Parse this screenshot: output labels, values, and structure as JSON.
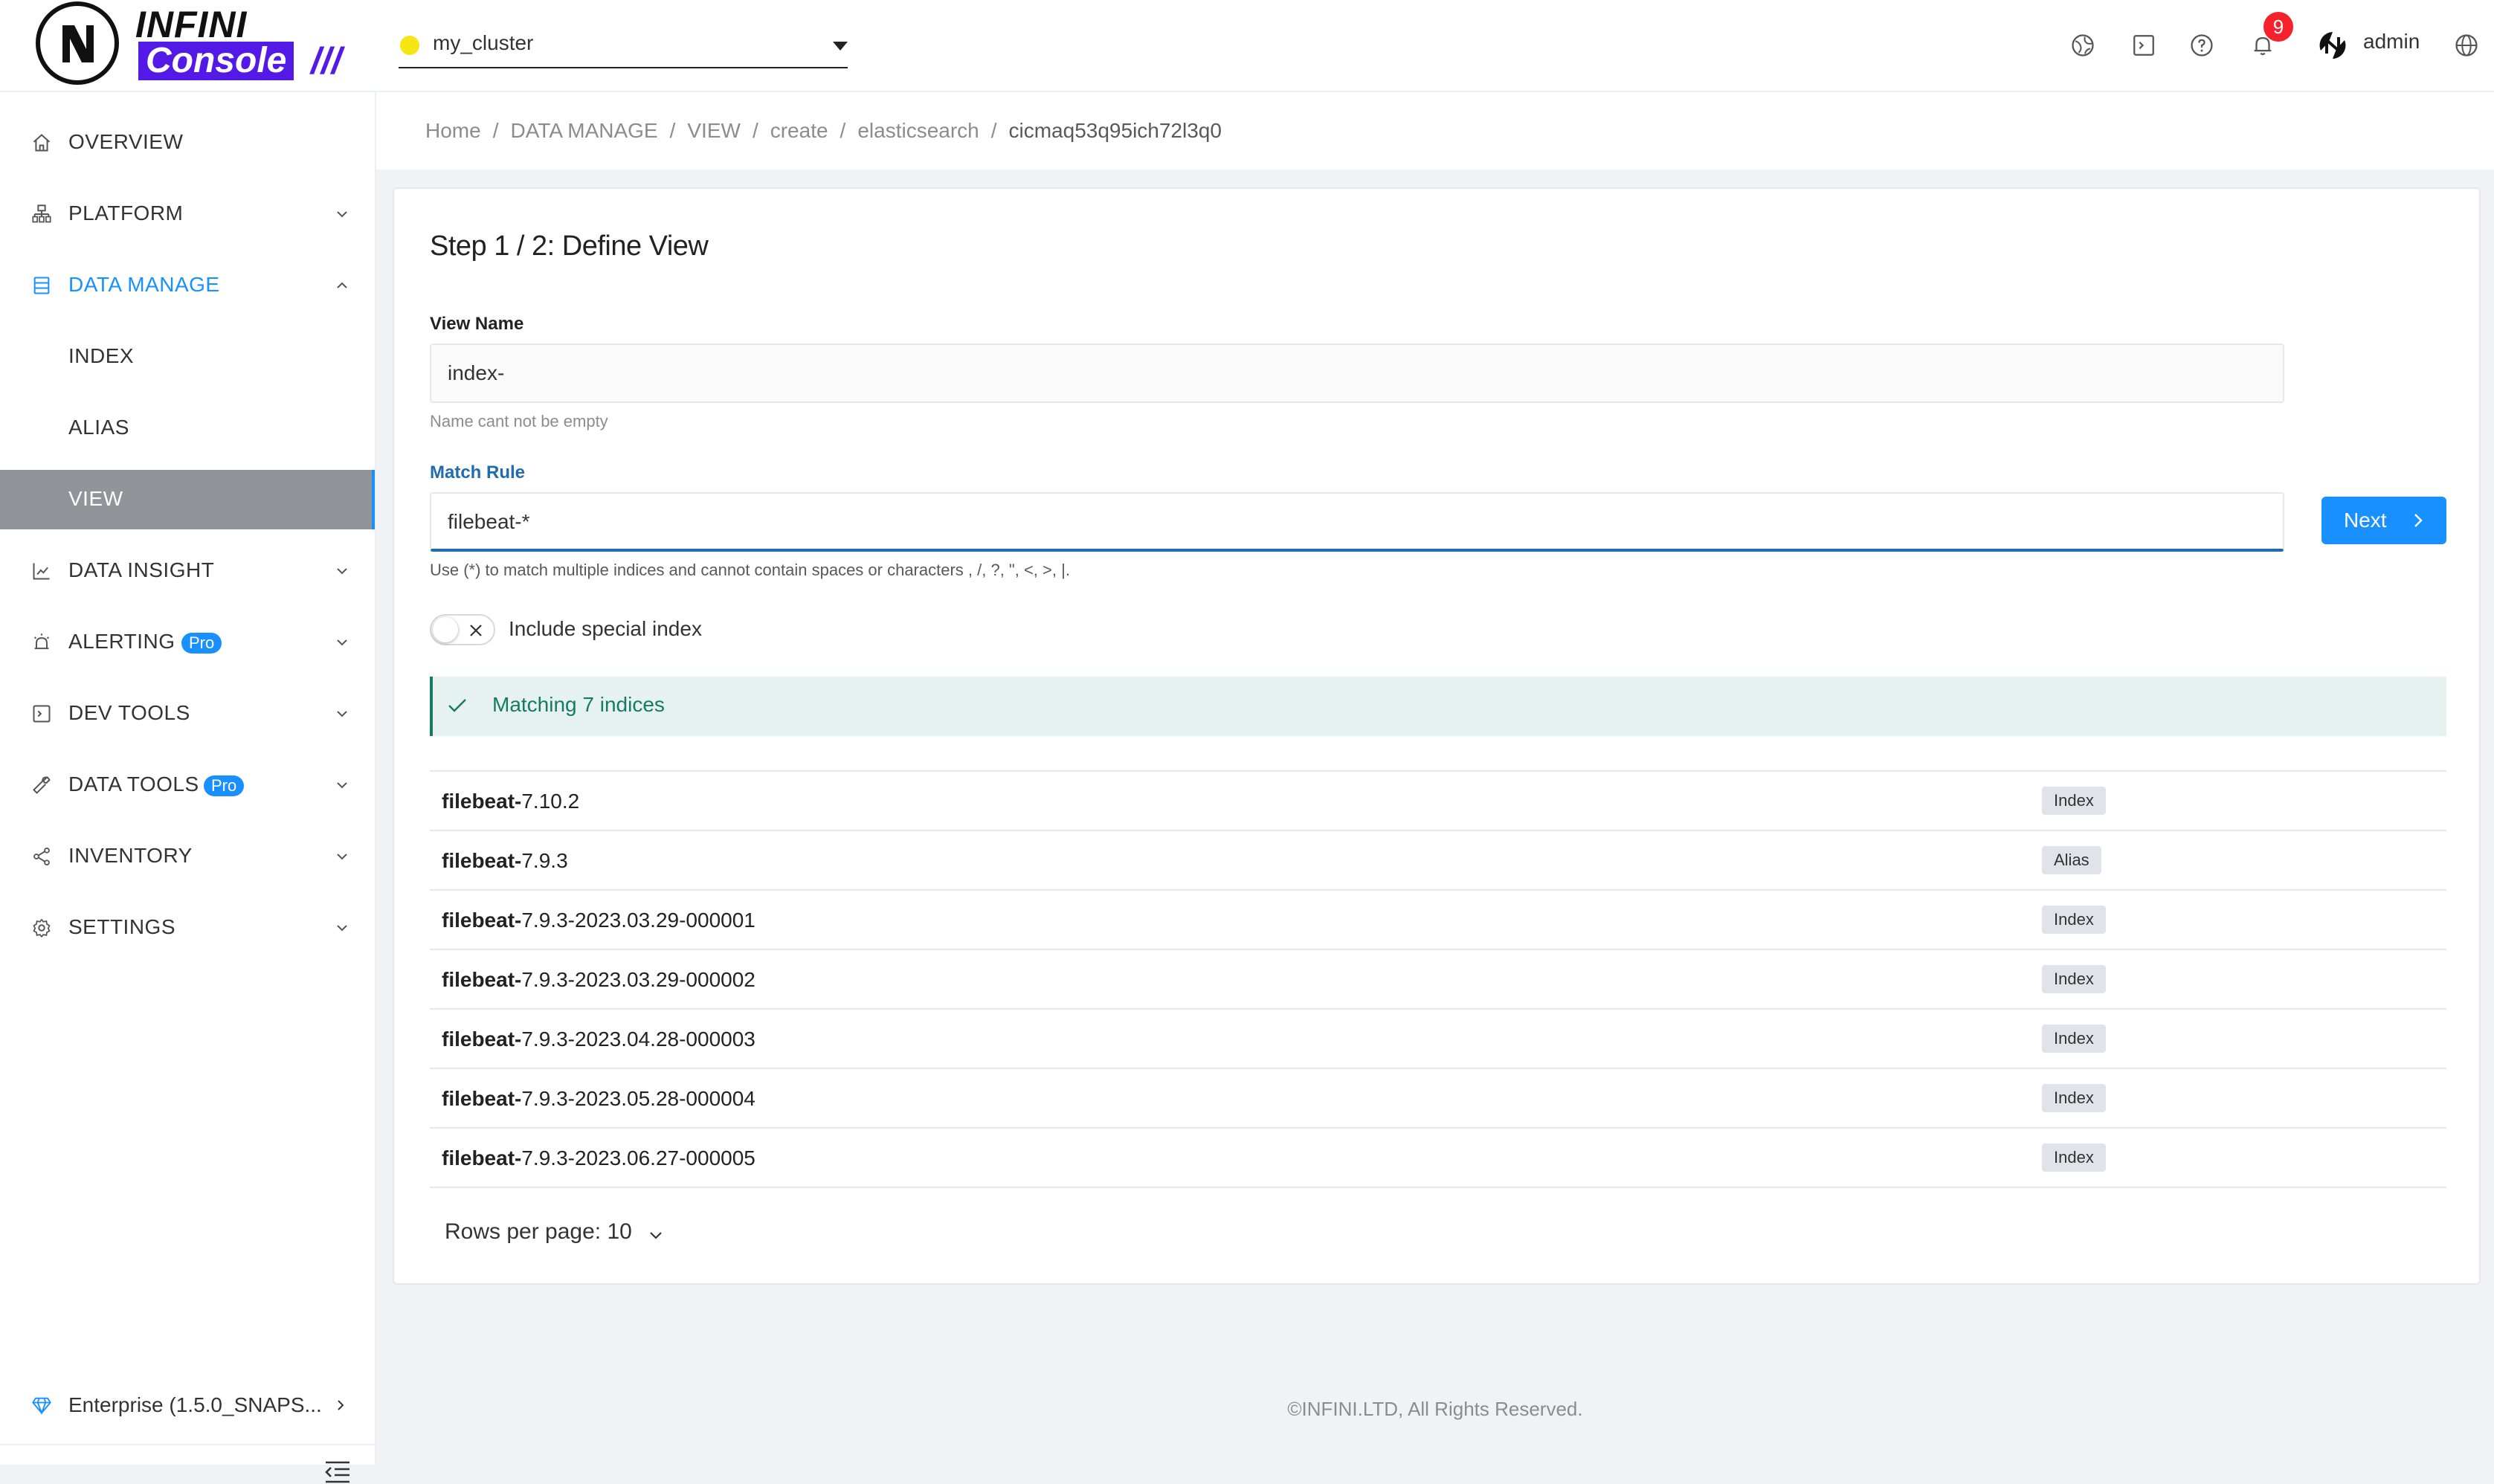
{
  "brand": {
    "name_top": "INFINI",
    "name_bottom": "Console",
    "slashes": "///"
  },
  "header": {
    "cluster": {
      "name": "my_cluster",
      "status_color": "#f5e614"
    },
    "icons": [
      "language-icon",
      "terminal-icon",
      "help-icon",
      "bell-icon"
    ],
    "notifications_count": "9",
    "user": "admin"
  },
  "sidebar": {
    "items": [
      {
        "label": "OVERVIEW",
        "icon": "home-icon"
      },
      {
        "label": "PLATFORM",
        "icon": "platform-icon"
      },
      {
        "label": "DATA MANAGE",
        "icon": "database-icon"
      },
      {
        "label": "INDEX"
      },
      {
        "label": "ALIAS"
      },
      {
        "label": "VIEW"
      },
      {
        "label": "DATA INSIGHT",
        "icon": "chart-icon"
      },
      {
        "label": "ALERTING",
        "icon": "alarm-icon",
        "badge": "Pro"
      },
      {
        "label": "DEV TOOLS",
        "icon": "terminal-icon"
      },
      {
        "label": "DATA TOOLS",
        "icon": "wrench-icon",
        "badge": "Pro"
      },
      {
        "label": "INVENTORY",
        "icon": "share-icon"
      },
      {
        "label": "SETTINGS",
        "icon": "gear-icon"
      }
    ],
    "footer": {
      "edition": "Enterprise (1.5.0_SNAPS..."
    }
  },
  "breadcrumb": [
    "Home",
    "DATA MANAGE",
    "VIEW",
    "create",
    "elasticsearch",
    "cicmaq53q95ich72l3q0"
  ],
  "form": {
    "title": "Step 1 / 2: Define View",
    "view_name_label": "View Name",
    "view_name_value": "index-",
    "view_name_error": "Name cant not be empty",
    "match_rule_label": "Match Rule",
    "match_rule_value": "filebeat-*",
    "match_rule_help": "Use (*) to match multiple indices and cannot contain spaces or characters , /, ?, \", <, >, |.",
    "next_label": "Next",
    "include_special_label": "Include special index",
    "include_special_on": false,
    "match_banner": "Matching 7 indices"
  },
  "indices": [
    {
      "prefix": "filebeat-",
      "rest": "7.10.2",
      "type": "Index"
    },
    {
      "prefix": "filebeat-",
      "rest": "7.9.3",
      "type": "Alias"
    },
    {
      "prefix": "filebeat-",
      "rest": "7.9.3-2023.03.29-000001",
      "type": "Index"
    },
    {
      "prefix": "filebeat-",
      "rest": "7.9.3-2023.03.29-000002",
      "type": "Index"
    },
    {
      "prefix": "filebeat-",
      "rest": "7.9.3-2023.04.28-000003",
      "type": "Index"
    },
    {
      "prefix": "filebeat-",
      "rest": "7.9.3-2023.05.28-000004",
      "type": "Index"
    },
    {
      "prefix": "filebeat-",
      "rest": "7.9.3-2023.06.27-000005",
      "type": "Index"
    }
  ],
  "pagination": {
    "rows_per_page": "Rows per page: 10"
  },
  "footer": {
    "copyright": "©INFINI.LTD, All Rights Reserved."
  },
  "colors": {
    "accent": "#1890ff",
    "success": "#177a63",
    "brand": "#5319e7",
    "badge": "#f5222d"
  }
}
